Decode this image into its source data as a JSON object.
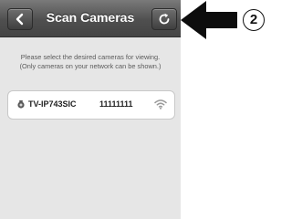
{
  "header": {
    "title": "Scan Cameras",
    "back_icon": "back-arrow-icon",
    "refresh_icon": "refresh-icon"
  },
  "instructions": {
    "line1": "Please select the desired cameras for viewing.",
    "line2": "(Only cameras on your network can be shown.)"
  },
  "cameras": [
    {
      "name": "TV-IP743SIC",
      "id": "11111111",
      "icon": "camera-icon",
      "signal_icon": "wifi-icon"
    }
  ],
  "callout": {
    "number": "2",
    "arrow_icon": "left-arrow-icon"
  },
  "colors": {
    "navbar": "#4f4f4f",
    "background": "#e6e6e6",
    "text": "#222222"
  }
}
